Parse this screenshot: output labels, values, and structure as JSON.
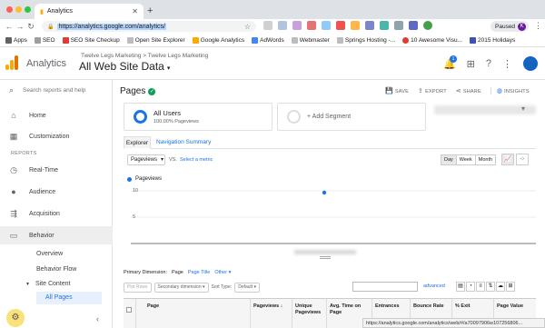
{
  "browser": {
    "tab_title": "Analytics",
    "url": "https://analytics.google.com/analytics/",
    "profile_status": "Paused",
    "profile_initial": "K",
    "bookmarks": [
      "Apps",
      "SEO",
      "SEO Site Checkup",
      "Open Site Explorer",
      "Google Analytics",
      "AdWords",
      "Webmaster",
      "Springs Hosting -...",
      "10 Awesome Visu...",
      "2015 Holidays"
    ],
    "status_url": "https://analytics.google.com/analytics/web/#/a70097906w107256806..."
  },
  "header": {
    "product": "Analytics",
    "breadcrumb": "Twelve Legs Marketing  >  Twelve Legs Marketing",
    "view_name": "All Web Site Data",
    "notification_count": "1"
  },
  "sidebar": {
    "search_placeholder": "Search reports and help",
    "home": "Home",
    "customization": "Customization",
    "reports_label": "REPORTS",
    "realtime": "Real-Time",
    "audience": "Audience",
    "acquisition": "Acquisition",
    "behavior": "Behavior",
    "overview": "Overview",
    "behavior_flow": "Behavior Flow",
    "site_content": "Site Content",
    "all_pages": "All Pages"
  },
  "page": {
    "title": "Pages",
    "actions": {
      "save": "SAVE",
      "export": "EXPORT",
      "share": "SHARE",
      "insights": "INSIGHTS"
    },
    "segment": {
      "name": "All Users",
      "sub": "100.00% Pageviews"
    },
    "add_segment": "+ Add Segment",
    "tabs": {
      "explorer": "Explorer",
      "nav_summary": "Navigation Summary"
    },
    "metric": "Pageviews",
    "vs": "VS.",
    "select_metric": "Select a metric",
    "granularity": [
      "Day",
      "Week",
      "Month"
    ],
    "primary_dimension_label": "Primary Dimension:",
    "dim_page": "Page",
    "dim_page_title": "Page Title",
    "dim_other": "Other",
    "toolbar": {
      "plot_rows": "Plot Rows",
      "secondary_dimension": "Secondary dimension",
      "sort_type_label": "Sort Type:",
      "sort_type": "Default",
      "advanced": "advanced"
    },
    "columns": [
      "Page",
      "Pageviews",
      "Unique Pageviews",
      "Avg. Time on Page",
      "Entrances",
      "Bounce Rate",
      "% Exit",
      "Page Value"
    ]
  },
  "chart_data": {
    "type": "scatter",
    "series": [
      {
        "name": "Pageviews",
        "values": [
          10
        ]
      }
    ],
    "yticks": [
      "10",
      "5"
    ],
    "ylim": [
      0,
      10
    ],
    "accent": "#1a73e8"
  }
}
